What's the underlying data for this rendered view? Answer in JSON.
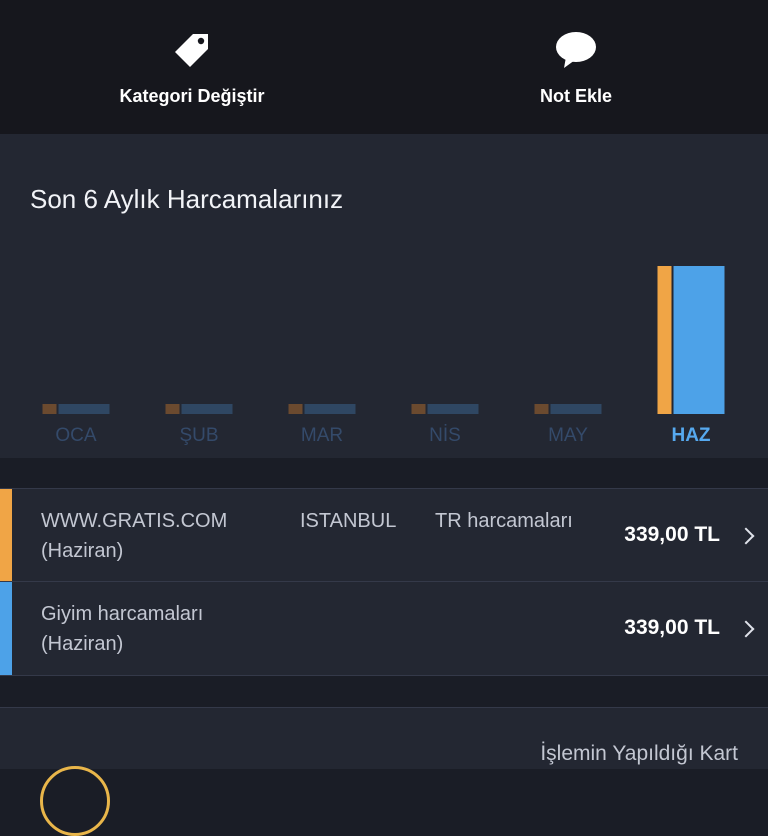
{
  "actions": {
    "category": {
      "label": "Kategori Değiştir",
      "icon": "tag-icon"
    },
    "note": {
      "label": "Not Ekle",
      "icon": "speech-bubble-icon"
    }
  },
  "chart_data": {
    "type": "bar",
    "title": "Son 6 Aylık Harcamalarınız",
    "categories": [
      "OCA",
      "ŞUB",
      "MAR",
      "NİS",
      "MAY",
      "HAZ"
    ],
    "selected": "HAZ",
    "series": [
      {
        "color": "#f0a546",
        "values": [
          0,
          0,
          0,
          0,
          0,
          339
        ]
      },
      {
        "color": "#4da2e8",
        "values": [
          0,
          0,
          0,
          0,
          0,
          339
        ]
      }
    ],
    "ylim": [
      0,
      339
    ],
    "xlabel": "",
    "ylabel": "",
    "grid": false
  },
  "transactions": [
    {
      "merchant": "WWW.GRATIS.COM",
      "city": "ISTANBUL",
      "category": "TR harcamaları",
      "month": "(Haziran)",
      "amount": "339,00 TL",
      "color": "#f0a546"
    },
    {
      "category": "Giyim harcamaları",
      "month": "(Haziran)",
      "amount": "339,00 TL",
      "color": "#4da2e8"
    }
  ],
  "card_section": {
    "label": "İşlemin Yapıldığı Kart"
  },
  "colors": {
    "orange": "#f0a546",
    "blue": "#4da2e8",
    "label_inactive": "#344a6a",
    "label_active": "#56a9ef",
    "track_inactive": "#2f4763",
    "track_inactive_orange": "#6b4a2f"
  }
}
